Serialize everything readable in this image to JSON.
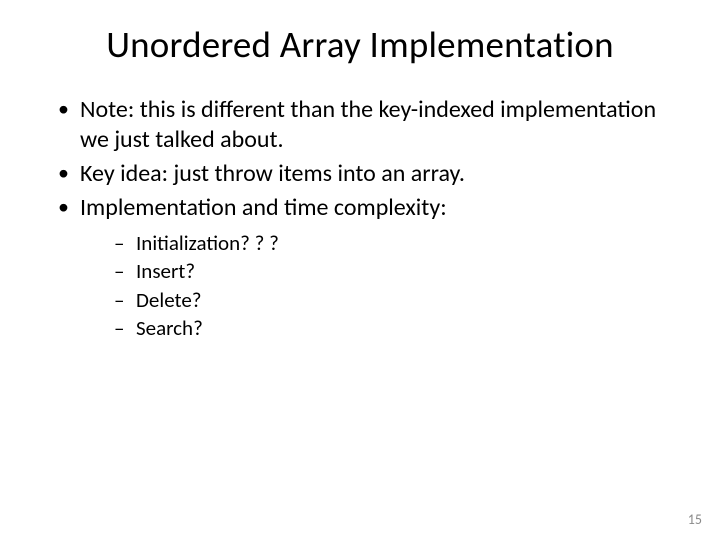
{
  "title": "Unordered Array Implementation",
  "bullets": {
    "b1": "Note: this is different than the key-indexed implementation we just talked about.",
    "b2": "Key idea: just throw items into an array.",
    "b3": "Implementation and time complexity:",
    "sub": {
      "s1": "Initialization? ? ?",
      "s2": "Insert?",
      "s3": "Delete?",
      "s4": "Search?"
    }
  },
  "page_number": "15"
}
